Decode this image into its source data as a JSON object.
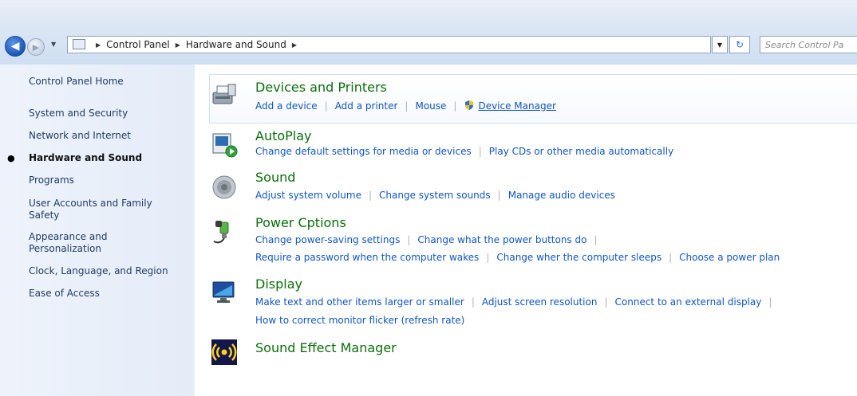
{
  "navbar": {
    "breadcrumbs": [
      "Control Panel",
      "Hardware and Sound"
    ],
    "search_placeholder": "Search Control Pa"
  },
  "sidebar": {
    "items": [
      {
        "label": "Control Panel Home"
      },
      {
        "label": "System and Security"
      },
      {
        "label": "Network and Internet"
      },
      {
        "label": "Hardware and Sound",
        "current": true
      },
      {
        "label": "Programs"
      },
      {
        "label": "User Accounts and Family\nSafety"
      },
      {
        "label": "Appearance and\nPersonalization"
      },
      {
        "label": "Clock, Language, and Region"
      },
      {
        "label": "Ease of Access"
      }
    ]
  },
  "categories": [
    {
      "title": "Devices and Printers",
      "icon": "printer-icon",
      "rows": [
        [
          "Add a device",
          "Add a printer",
          "Mouse",
          "Device Manager"
        ]
      ]
    },
    {
      "title": "AutoPlay",
      "icon": "autoplay-icon",
      "rows": [
        [
          "Change default settings for media or devices",
          "Play CDs or other media automatically"
        ]
      ]
    },
    {
      "title": "Sound",
      "icon": "speaker-icon",
      "rows": [
        [
          "Adjust system volume",
          "Change system sounds",
          "Manage audio devices"
        ]
      ]
    },
    {
      "title": "Power Cptions",
      "icon": "power-icon",
      "rows": [
        [
          "Change power-saving settings",
          "Change what the power buttons do"
        ],
        [
          "Require a password when the computer wakes",
          "Change wher the computer sleeps",
          "Choose a power plan"
        ]
      ]
    },
    {
      "title": "Display",
      "icon": "display-icon",
      "rows": [
        [
          "Make text and other items larger or smaller",
          "Adjust screen resolution",
          "Connect to an external display"
        ],
        [
          "How to correct monitor flicker (refresh rate)"
        ]
      ]
    },
    {
      "title": "Sound Effect Manager",
      "icon": "sound-effect-icon",
      "rows": []
    }
  ]
}
